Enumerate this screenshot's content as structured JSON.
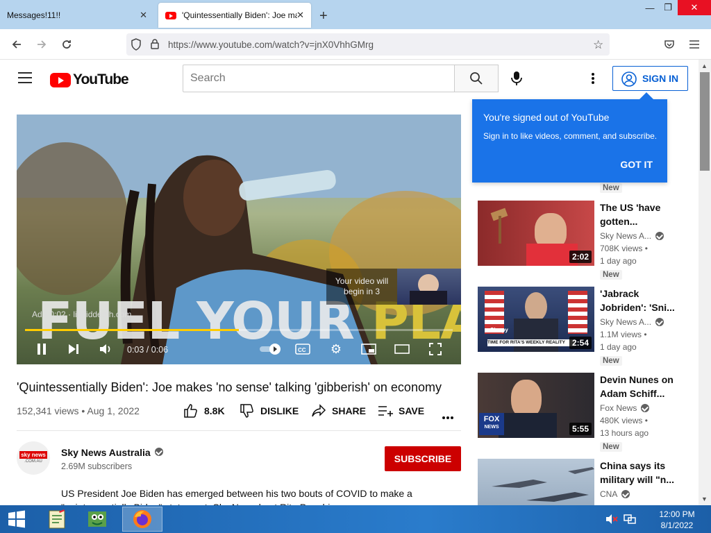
{
  "browser": {
    "tabs": [
      {
        "label": "Messages!11!!",
        "active": false
      },
      {
        "label": "'Quintessentially Biden': Joe ma",
        "active": true
      }
    ],
    "url": "https://www.youtube.com/watch?v=jnX0VhhGMrg"
  },
  "youtube": {
    "logo_text": "YouTube",
    "search_placeholder": "Search",
    "sign_in": "SIGN IN",
    "popup": {
      "title": "You're signed out of YouTube",
      "body": "Sign in to like videos, comment, and subscribe.",
      "button": "GOT IT"
    },
    "player": {
      "overlay_text_1": "FUEL YOUR ",
      "overlay_text_2": "PLAY",
      "ad_badge": "Ad · 0:02 · liquiddeath.com",
      "ad_countdown": "Your video will begin in 3",
      "time": "0:03 / 0:06",
      "progress": 0.5
    },
    "video": {
      "title": "'Quintessentially Biden': Joe makes 'no sense' talking 'gibberish' on economy",
      "meta": "152,341 views • Aug 1, 2022",
      "likes": "8.8K",
      "dislike": "DISLIKE",
      "share": "SHARE",
      "save": "SAVE"
    },
    "channel": {
      "name": "Sky News Australia",
      "subscribers": "2.69M subscribers",
      "subscribe": "SUBSCRIBE",
      "avatar_text_1": "sky news",
      "avatar_text_2": ".COM.AU"
    },
    "description": "US President Joe Biden has emerged between his two bouts of COVID to make a \"quintessentially Biden\" statement, Sky News host Rita Panahi says.",
    "sidebar_top_badge": "New",
    "sidebar": [
      {
        "title": "The US 'have gotten...",
        "channel": "Sky News A...",
        "views": "708K views •",
        "date": "1 day ago",
        "badge": "New",
        "duration": "2:02"
      },
      {
        "title": "'Jabrack Jobriden': 'Sni...",
        "channel": "Sky News A...",
        "views": "1.1M views •",
        "date": "1 day ago",
        "badge": "New",
        "duration": "2:54",
        "thumb_caption_1": "Sleepy",
        "thumb_caption_2": "TIME FOR RITA'S WEEKLY REALITY"
      },
      {
        "title": "Devin Nunes on Adam Schiff...",
        "channel": "Fox News",
        "views": "480K views •",
        "date": "13 hours ago",
        "badge": "New",
        "duration": "5:55",
        "thumb_caption_1": "FOX",
        "thumb_caption_2": "NEWS"
      },
      {
        "title": "China says its military will \"n...",
        "channel": "CNA",
        "views": "",
        "date": "",
        "badge": "",
        "duration": ""
      }
    ]
  },
  "taskbar": {
    "time": "12:00 PM",
    "date": "8/1/2022"
  },
  "colors": {
    "youtube_red": "#ff0000",
    "subscribe_red": "#cc0000",
    "link_blue": "#065fd4",
    "popup_blue": "#1a73e8",
    "taskbar_blue": "#1d66b3",
    "titlebar_blue": "#b6d4ee"
  }
}
